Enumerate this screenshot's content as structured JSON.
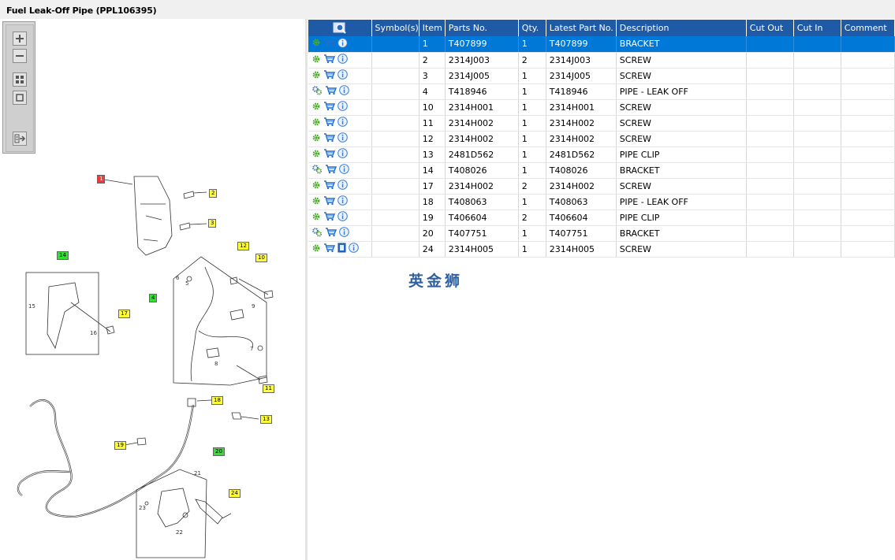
{
  "window": {
    "title": "Fuel Leak-Off Pipe (PPL106395)"
  },
  "table": {
    "columns": [
      "",
      "Symbol(s)",
      "Item",
      "Parts No.",
      "Qty.",
      "Latest Part No.",
      "Description",
      "Cut Out",
      "Cut In",
      "Comment"
    ],
    "rows": [
      {
        "item": "1",
        "part_no": "T407899",
        "qty": "1",
        "latest": "T407899",
        "desc": "BRACKET",
        "gear": "single",
        "selected": true
      },
      {
        "item": "2",
        "part_no": "2314J003",
        "qty": "2",
        "latest": "2314J003",
        "desc": "SCREW",
        "gear": "single"
      },
      {
        "item": "3",
        "part_no": "2314J005",
        "qty": "1",
        "latest": "2314J005",
        "desc": "SCREW",
        "gear": "single"
      },
      {
        "item": "4",
        "part_no": "T418946",
        "qty": "1",
        "latest": "T418946",
        "desc": "PIPE - LEAK OFF",
        "gear": "double"
      },
      {
        "item": "10",
        "part_no": "2314H001",
        "qty": "1",
        "latest": "2314H001",
        "desc": "SCREW",
        "gear": "single"
      },
      {
        "item": "11",
        "part_no": "2314H002",
        "qty": "1",
        "latest": "2314H002",
        "desc": "SCREW",
        "gear": "single"
      },
      {
        "item": "12",
        "part_no": "2314H002",
        "qty": "1",
        "latest": "2314H002",
        "desc": "SCREW",
        "gear": "single"
      },
      {
        "item": "13",
        "part_no": "2481D562",
        "qty": "1",
        "latest": "2481D562",
        "desc": "PIPE CLIP",
        "gear": "single"
      },
      {
        "item": "14",
        "part_no": "T408026",
        "qty": "1",
        "latest": "T408026",
        "desc": "BRACKET",
        "gear": "double"
      },
      {
        "item": "17",
        "part_no": "2314H002",
        "qty": "2",
        "latest": "2314H002",
        "desc": "SCREW",
        "gear": "single"
      },
      {
        "item": "18",
        "part_no": "T408063",
        "qty": "1",
        "latest": "T408063",
        "desc": "PIPE - LEAK OFF",
        "gear": "single"
      },
      {
        "item": "19",
        "part_no": "T406604",
        "qty": "2",
        "latest": "T406604",
        "desc": "PIPE CLIP",
        "gear": "single"
      },
      {
        "item": "20",
        "part_no": "T407751",
        "qty": "1",
        "latest": "T407751",
        "desc": "BRACKET",
        "gear": "double"
      },
      {
        "item": "24",
        "part_no": "2314H005",
        "qty": "1",
        "latest": "2314H005",
        "desc": "SCREW",
        "gear": "single",
        "doc": true
      }
    ]
  },
  "watermark": "英金狮",
  "diagram": {
    "callouts": [
      {
        "label": "1",
        "color": "red"
      },
      {
        "label": "2",
        "color": "yellow"
      },
      {
        "label": "3",
        "color": "yellow"
      },
      {
        "label": "14",
        "color": "green"
      },
      {
        "label": "17",
        "color": "yellow"
      },
      {
        "label": "4",
        "color": "green"
      },
      {
        "label": "12",
        "color": "yellow"
      },
      {
        "label": "10",
        "color": "yellow"
      },
      {
        "label": "11",
        "color": "yellow"
      },
      {
        "label": "18",
        "color": "yellow"
      },
      {
        "label": "13",
        "color": "yellow"
      },
      {
        "label": "19",
        "color": "yellow"
      },
      {
        "label": "20",
        "color": "green"
      },
      {
        "label": "24",
        "color": "yellow"
      }
    ],
    "plain_numbers": [
      "15",
      "16",
      "6",
      "5",
      "9",
      "7",
      "8",
      "21",
      "23",
      "22"
    ]
  },
  "colors": {
    "header": "#1f5aa6",
    "selected_row": "#0078d7",
    "gear": "#4caa2e",
    "cart": "#1f6fd0",
    "info": "#3a7fd5"
  },
  "toolbox": {
    "tools": [
      "zoom-in-icon",
      "zoom-out-icon",
      "fit-all-icon",
      "actual-size-icon",
      "export-icon"
    ]
  }
}
